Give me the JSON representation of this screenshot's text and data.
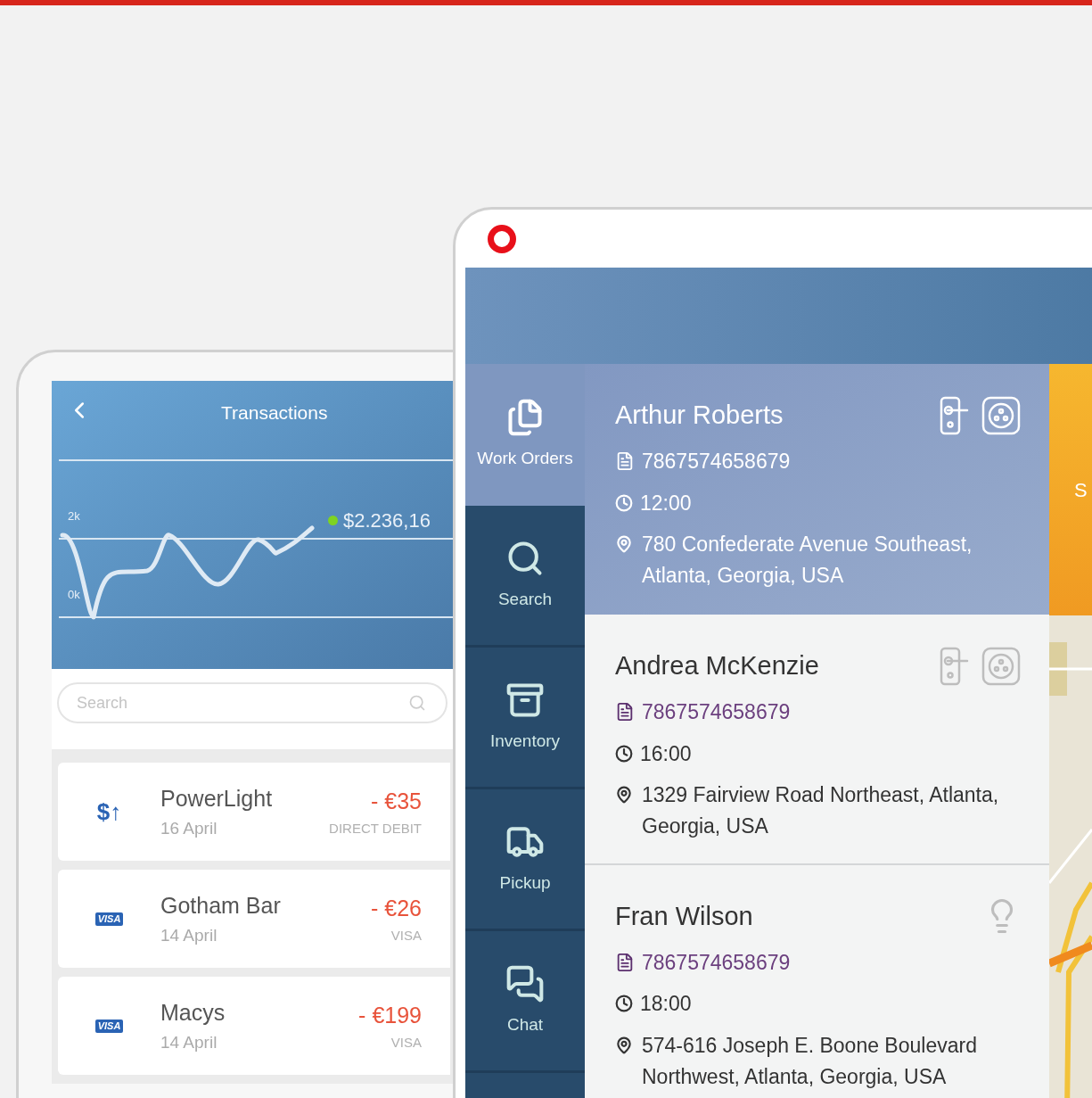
{
  "transactions_app": {
    "title": "Transactions",
    "balance": "$2.236,16",
    "axis_labels": [
      "2k",
      "0k"
    ],
    "search": {
      "placeholder": "Search"
    },
    "rows": [
      {
        "kind": "direct_debit",
        "icon_text": "$↑",
        "name": "PowerLight",
        "date": "16 April",
        "amount": "- €35",
        "method": "DIRECT DEBIT"
      },
      {
        "kind": "visa",
        "icon_text": "VISA",
        "name": "Gotham Bar",
        "date": "14 April",
        "amount": "- €26",
        "method": "VISA"
      },
      {
        "kind": "visa",
        "icon_text": "VISA",
        "name": "Macys",
        "date": "14 April",
        "amount": "- €199",
        "method": "VISA"
      }
    ]
  },
  "work_orders_app": {
    "sidebar": [
      {
        "label": "Work Orders",
        "kind": "documents",
        "selected": true
      },
      {
        "label": "Search",
        "kind": "search",
        "selected": false
      },
      {
        "label": "Inventory",
        "kind": "box",
        "selected": false
      },
      {
        "label": "Pickup",
        "kind": "truck",
        "selected": false
      },
      {
        "label": "Chat",
        "kind": "chat",
        "selected": false
      }
    ],
    "orders": [
      {
        "name": "Arthur Roberts",
        "number": "7867574658679",
        "time": "12:00",
        "address": "780 Confederate Avenue Southeast, Atlanta, Georgia, USA",
        "icons": [
          {
            "kind": "door"
          },
          {
            "kind": "socket"
          }
        ],
        "selected": true
      },
      {
        "name": "Andrea McKenzie",
        "number": "7867574658679",
        "time": "16:00",
        "address": "1329 Fairview Road Northeast, Atlanta, Georgia, USA",
        "icons": [
          {
            "kind": "door"
          },
          {
            "kind": "socket"
          }
        ],
        "selected": false
      },
      {
        "name": "Fran Wilson",
        "number": "7867574658679",
        "time": "18:00",
        "address": "574-616 Joseph E. Boone Boulevard Northwest, Atlanta, Georgia, USA",
        "icons": [
          {
            "kind": "bulb"
          }
        ],
        "selected": false
      }
    ],
    "side_tab": "S"
  }
}
